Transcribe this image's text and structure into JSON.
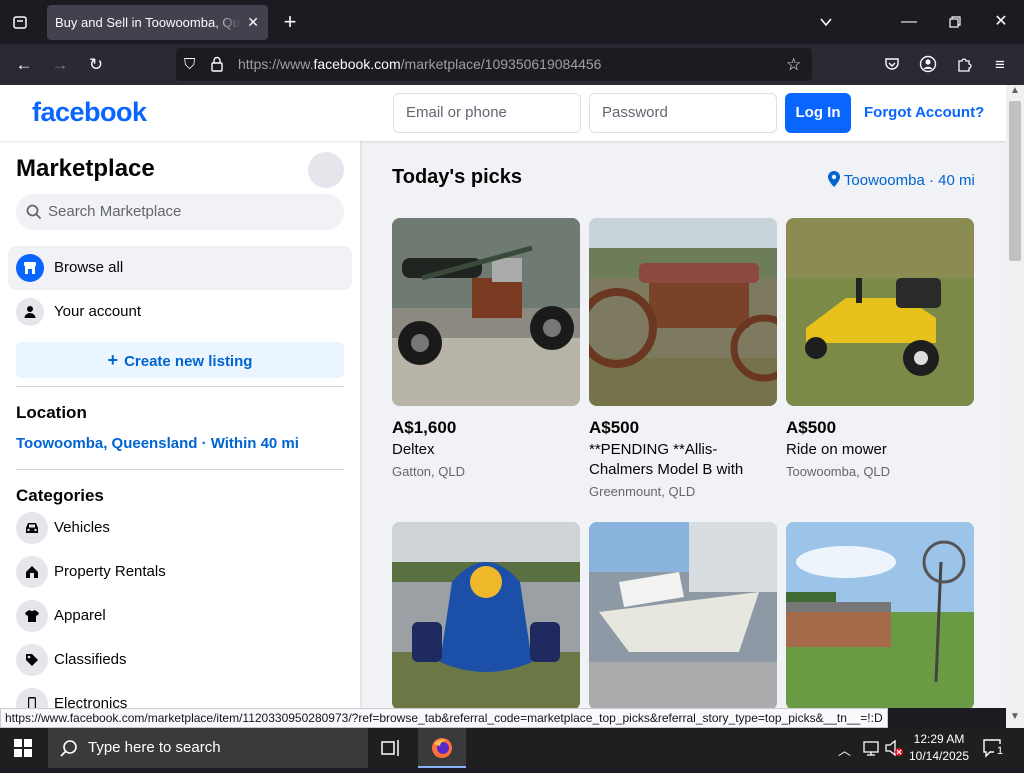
{
  "browser": {
    "tab_title": "Buy and Sell in Toowoomba, Queensland",
    "url_prefix": "https://www.",
    "url_domain": "facebook.com",
    "url_path": "/marketplace/109350619084456",
    "status_url": "https://www.facebook.com/marketplace/item/1120330950280973/?ref=browse_tab&referral_code=marketplace_top_picks&referral_story_type=top_picks&__tn__=!:D"
  },
  "header": {
    "logo": "facebook",
    "email_placeholder": "Email or phone",
    "password_placeholder": "Password",
    "login_label": "Log In",
    "forgot_label": "Forgot Account?"
  },
  "sidebar": {
    "title": "Marketplace",
    "search_placeholder": "Search Marketplace",
    "browse_all": "Browse all",
    "your_account": "Your account",
    "create_listing": "Create new listing",
    "location_heading": "Location",
    "location_value": "Toowoomba, Queensland · Within 40 mi",
    "categories_heading": "Categories",
    "categories": [
      {
        "label": "Vehicles",
        "icon": "car-icon"
      },
      {
        "label": "Property Rentals",
        "icon": "house-icon"
      },
      {
        "label": "Apparel",
        "icon": "shirt-icon"
      },
      {
        "label": "Classifieds",
        "icon": "tag-icon"
      },
      {
        "label": "Electronics",
        "icon": "phone-icon"
      }
    ]
  },
  "main": {
    "picks_title": "Today's picks",
    "picks_location": "Toowoomba · 40 mi",
    "listings": [
      {
        "price": "A$1,600",
        "title": "Deltex",
        "location": "Gatton, QLD"
      },
      {
        "price": "A$500",
        "title": "**PENDING **Allis-Chalmers Model B with steel wheels...",
        "location": "Greenmount, QLD"
      },
      {
        "price": "A$500",
        "title": "Ride on mower",
        "location": "Toowoomba, QLD"
      },
      {
        "price": "",
        "title": "",
        "location": ""
      },
      {
        "price": "",
        "title": "",
        "location": ""
      },
      {
        "price": "",
        "title": "",
        "location": ""
      }
    ]
  },
  "taskbar": {
    "search_placeholder": "Type here to search",
    "time": "12:29 AM",
    "date": "10/14/2025",
    "notification_count": "1"
  }
}
